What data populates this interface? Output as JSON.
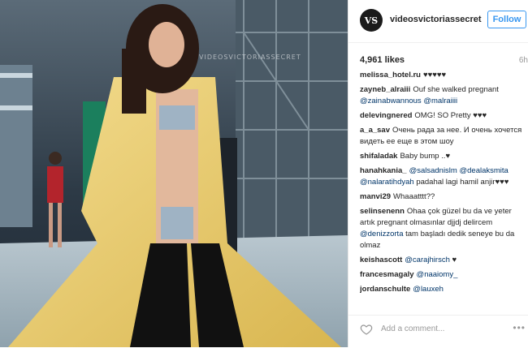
{
  "photo": {
    "description_icon": "runway-photo",
    "watermark": "VIDEOSVICTORIASSECRET"
  },
  "header": {
    "avatar_text": "VS",
    "username": "videosvictoriassecret",
    "follow_label": "Follow"
  },
  "post": {
    "likes": "4,961 likes",
    "age": "6h"
  },
  "comments": [
    {
      "user": "melissa_hotel.ru",
      "parts": [
        {
          "t": "♥♥♥♥♥",
          "m": false
        }
      ]
    },
    {
      "user": "zayneb_alraiii",
      "parts": [
        {
          "t": "Ouf she walked pregnant ",
          "m": false
        },
        {
          "t": "@zainabwannous",
          "m": true
        },
        {
          "t": " ",
          "m": false
        },
        {
          "t": "@malraiiii",
          "m": true
        }
      ]
    },
    {
      "user": "delevingnered",
      "parts": [
        {
          "t": "OMG! SO Pretty ♥♥♥",
          "m": false
        }
      ]
    },
    {
      "user": "a_a_sav",
      "parts": [
        {
          "t": "Очень рада за нее. И очень хочется видеть ее еще в этом шоу",
          "m": false
        }
      ]
    },
    {
      "user": "shifaladak",
      "parts": [
        {
          "t": "Baby bump ..♥",
          "m": false
        }
      ]
    },
    {
      "user": "hanahkania_",
      "parts": [
        {
          "t": "@salsadnislm",
          "m": true
        },
        {
          "t": " ",
          "m": false
        },
        {
          "t": "@dealaksmita",
          "m": true
        },
        {
          "t": " ",
          "m": false
        },
        {
          "t": "@nalaratihdyah",
          "m": true
        },
        {
          "t": " padahal lagi hamil anjir♥♥♥",
          "m": false
        }
      ]
    },
    {
      "user": "manvi29",
      "parts": [
        {
          "t": "Whaaatttt??",
          "m": false
        }
      ]
    },
    {
      "user": "selinsenenn",
      "parts": [
        {
          "t": "Ohaa çok güzel bu da ve yeter artık pregnant olmasınlar djjdj delircem ",
          "m": false
        },
        {
          "t": "@denizzorta",
          "m": true
        },
        {
          "t": " tam başladı dedik seneye bu da olmaz",
          "m": false
        }
      ]
    },
    {
      "user": "keishascott",
      "parts": [
        {
          "t": "@carajhirsch",
          "m": true
        },
        {
          "t": " ♥",
          "m": false
        }
      ]
    },
    {
      "user": "francesmagaly",
      "parts": [
        {
          "t": "@naaiomy_",
          "m": true
        }
      ]
    },
    {
      "user": "jordanschulte",
      "parts": [
        {
          "t": "@lauxeh",
          "m": true
        }
      ]
    }
  ],
  "footer": {
    "placeholder": "Add a comment...",
    "heart_icon": "heart-icon",
    "more_icon": "more-options-icon"
  },
  "colors": {
    "accent": "#3897f0",
    "mention": "#003569",
    "text": "#262626",
    "muted": "#999999"
  }
}
